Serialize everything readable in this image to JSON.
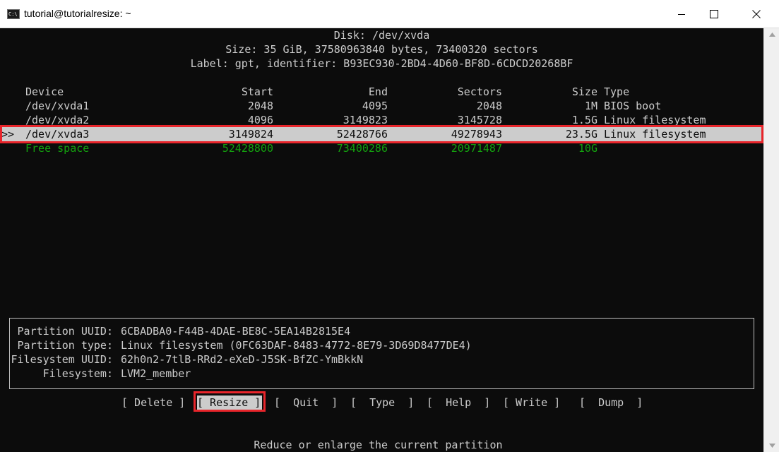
{
  "window": {
    "title": "tutorial@tutorialresize: ~",
    "icon_label": "C:\\"
  },
  "disk": {
    "heading": "Disk: /dev/xvda",
    "size_line": "Size: 35 GiB, 37580963840 bytes, 73400320 sectors",
    "label_line": "Label: gpt, identifier: B93EC930-2BD4-4D60-BF8D-6CDCD20268BF"
  },
  "table": {
    "headers": {
      "device": "Device",
      "start": "Start",
      "end": "End",
      "sectors": "Sectors",
      "size": "Size",
      "type": "Type"
    },
    "rows": [
      {
        "marker": "",
        "device": "/dev/xvda1",
        "start": "2048",
        "end": "4095",
        "sectors": "2048",
        "size": "1M",
        "type": "BIOS boot"
      },
      {
        "marker": "",
        "device": "/dev/xvda2",
        "start": "4096",
        "end": "3149823",
        "sectors": "3145728",
        "size": "1.5G",
        "type": "Linux filesystem"
      },
      {
        "marker": ">>",
        "device": "/dev/xvda3",
        "start": "3149824",
        "end": "52428766",
        "sectors": "49278943",
        "size": "23.5G",
        "type": "Linux filesystem"
      },
      {
        "marker": "",
        "device": "Free space",
        "start": "52428800",
        "end": "73400286",
        "sectors": "20971487",
        "size": "10G",
        "type": ""
      }
    ]
  },
  "partition_info": {
    "uuid_label": "Partition UUID:",
    "uuid_value": "6CBADBA0-F44B-4DAE-BE8C-5EA14B2815E4",
    "type_label": "Partition type:",
    "type_value": "Linux filesystem (0FC63DAF-8483-4772-8E79-3D69D8477DE4)",
    "fs_uuid_label": "Filesystem UUID:",
    "fs_uuid_value": "62h0n2-7tlB-RRd2-eXeD-J5SK-BfZC-YmBkkN",
    "fs_label": "Filesystem:",
    "fs_value": "LVM2_member"
  },
  "menu": {
    "delete": "[ Delete ]",
    "resize": "[ Resize ]",
    "quit": "[  Quit  ]",
    "type": "[  Type  ]",
    "help": "[  Help  ]",
    "write": "[ Write ]",
    "dump": "[  Dump  ]",
    "selected": "Resize"
  },
  "status": {
    "hint": "Reduce or enlarge the current partition"
  },
  "colors": {
    "terminal_bg": "#0c0c0c",
    "terminal_fg": "#cccccc",
    "free_space": "#13a10e",
    "highlight": "#e8252b"
  }
}
